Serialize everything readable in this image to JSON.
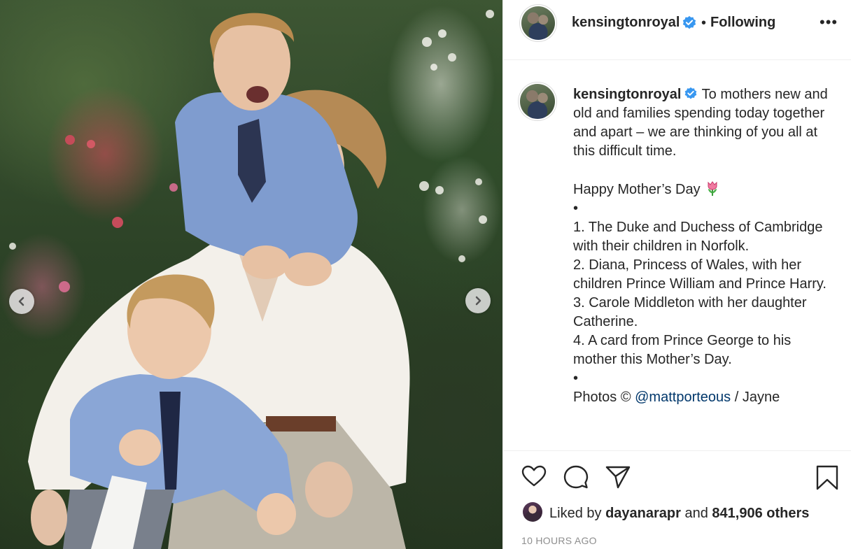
{
  "post": {
    "image_alt": "Photo carousel image"
  },
  "header": {
    "username": "kensingtonroyal",
    "separator": "•",
    "follow_status": "Following",
    "more": "•••"
  },
  "caption": {
    "username": "kensingtonroyal",
    "text_part1": " To mothers new and old and families spending today together and apart – we are thinking of you all at this difficult time.\n\nHappy Mother’s Day ",
    "tulip_icon": "tulip-emoji",
    "text_part2": "\n•\n1. The Duke and Duchess of Cambridge with their children in Norfolk.\n2. Diana, Princess of Wales, with her children Prince William and Prince Harry.\n3. Carole Middleton with her daughter Catherine.\n4. A card from Prince George to his mother this Mother’s Day.\n•\nPhotos © ",
    "mention": "@mattporteous",
    "text_part3": " / Jayne"
  },
  "likes": {
    "prefix": "Liked by ",
    "user": "dayanarapr",
    "middle": " and ",
    "count": "841,906 others"
  },
  "timestamp": "10 HOURS AGO",
  "icons": {
    "prev": "chevron-left-icon",
    "next": "chevron-right-icon",
    "like": "heart-icon",
    "comment": "comment-bubble-icon",
    "share": "paper-plane-icon",
    "save": "bookmark-icon",
    "verified": "verified-badge-icon"
  },
  "colors": {
    "verified": "#3897f0",
    "mention": "#00376b",
    "timestamp": "#8e8e8e",
    "text": "#262626"
  }
}
